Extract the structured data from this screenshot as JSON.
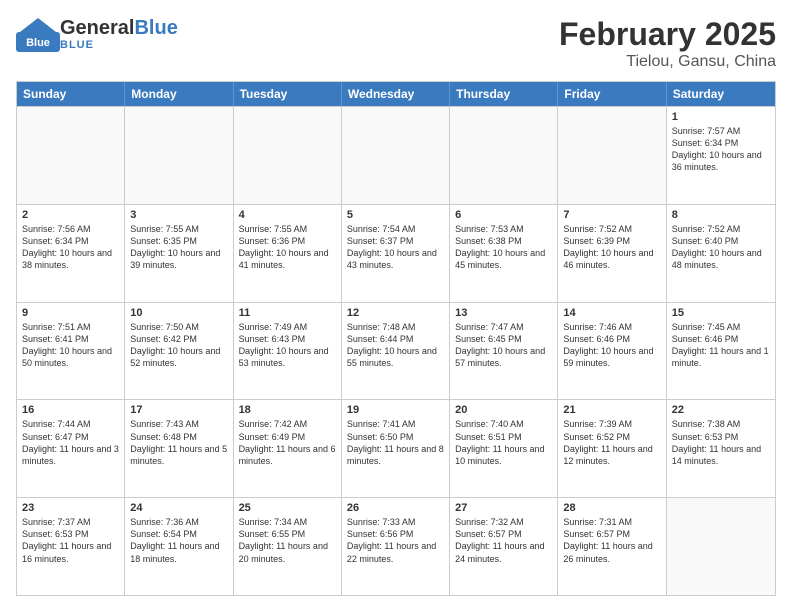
{
  "header": {
    "logo_general": "General",
    "logo_blue": "Blue",
    "title": "February 2025",
    "subtitle": "Tielou, Gansu, China"
  },
  "days_of_week": [
    "Sunday",
    "Monday",
    "Tuesday",
    "Wednesday",
    "Thursday",
    "Friday",
    "Saturday"
  ],
  "weeks": [
    [
      {
        "day": "",
        "text": ""
      },
      {
        "day": "",
        "text": ""
      },
      {
        "day": "",
        "text": ""
      },
      {
        "day": "",
        "text": ""
      },
      {
        "day": "",
        "text": ""
      },
      {
        "day": "",
        "text": ""
      },
      {
        "day": "1",
        "text": "Sunrise: 7:57 AM\nSunset: 6:34 PM\nDaylight: 10 hours and 36 minutes."
      }
    ],
    [
      {
        "day": "2",
        "text": "Sunrise: 7:56 AM\nSunset: 6:34 PM\nDaylight: 10 hours and 38 minutes."
      },
      {
        "day": "3",
        "text": "Sunrise: 7:55 AM\nSunset: 6:35 PM\nDaylight: 10 hours and 39 minutes."
      },
      {
        "day": "4",
        "text": "Sunrise: 7:55 AM\nSunset: 6:36 PM\nDaylight: 10 hours and 41 minutes."
      },
      {
        "day": "5",
        "text": "Sunrise: 7:54 AM\nSunset: 6:37 PM\nDaylight: 10 hours and 43 minutes."
      },
      {
        "day": "6",
        "text": "Sunrise: 7:53 AM\nSunset: 6:38 PM\nDaylight: 10 hours and 45 minutes."
      },
      {
        "day": "7",
        "text": "Sunrise: 7:52 AM\nSunset: 6:39 PM\nDaylight: 10 hours and 46 minutes."
      },
      {
        "day": "8",
        "text": "Sunrise: 7:52 AM\nSunset: 6:40 PM\nDaylight: 10 hours and 48 minutes."
      }
    ],
    [
      {
        "day": "9",
        "text": "Sunrise: 7:51 AM\nSunset: 6:41 PM\nDaylight: 10 hours and 50 minutes."
      },
      {
        "day": "10",
        "text": "Sunrise: 7:50 AM\nSunset: 6:42 PM\nDaylight: 10 hours and 52 minutes."
      },
      {
        "day": "11",
        "text": "Sunrise: 7:49 AM\nSunset: 6:43 PM\nDaylight: 10 hours and 53 minutes."
      },
      {
        "day": "12",
        "text": "Sunrise: 7:48 AM\nSunset: 6:44 PM\nDaylight: 10 hours and 55 minutes."
      },
      {
        "day": "13",
        "text": "Sunrise: 7:47 AM\nSunset: 6:45 PM\nDaylight: 10 hours and 57 minutes."
      },
      {
        "day": "14",
        "text": "Sunrise: 7:46 AM\nSunset: 6:46 PM\nDaylight: 10 hours and 59 minutes."
      },
      {
        "day": "15",
        "text": "Sunrise: 7:45 AM\nSunset: 6:46 PM\nDaylight: 11 hours and 1 minute."
      }
    ],
    [
      {
        "day": "16",
        "text": "Sunrise: 7:44 AM\nSunset: 6:47 PM\nDaylight: 11 hours and 3 minutes."
      },
      {
        "day": "17",
        "text": "Sunrise: 7:43 AM\nSunset: 6:48 PM\nDaylight: 11 hours and 5 minutes."
      },
      {
        "day": "18",
        "text": "Sunrise: 7:42 AM\nSunset: 6:49 PM\nDaylight: 11 hours and 6 minutes."
      },
      {
        "day": "19",
        "text": "Sunrise: 7:41 AM\nSunset: 6:50 PM\nDaylight: 11 hours and 8 minutes."
      },
      {
        "day": "20",
        "text": "Sunrise: 7:40 AM\nSunset: 6:51 PM\nDaylight: 11 hours and 10 minutes."
      },
      {
        "day": "21",
        "text": "Sunrise: 7:39 AM\nSunset: 6:52 PM\nDaylight: 11 hours and 12 minutes."
      },
      {
        "day": "22",
        "text": "Sunrise: 7:38 AM\nSunset: 6:53 PM\nDaylight: 11 hours and 14 minutes."
      }
    ],
    [
      {
        "day": "23",
        "text": "Sunrise: 7:37 AM\nSunset: 6:53 PM\nDaylight: 11 hours and 16 minutes."
      },
      {
        "day": "24",
        "text": "Sunrise: 7:36 AM\nSunset: 6:54 PM\nDaylight: 11 hours and 18 minutes."
      },
      {
        "day": "25",
        "text": "Sunrise: 7:34 AM\nSunset: 6:55 PM\nDaylight: 11 hours and 20 minutes."
      },
      {
        "day": "26",
        "text": "Sunrise: 7:33 AM\nSunset: 6:56 PM\nDaylight: 11 hours and 22 minutes."
      },
      {
        "day": "27",
        "text": "Sunrise: 7:32 AM\nSunset: 6:57 PM\nDaylight: 11 hours and 24 minutes."
      },
      {
        "day": "28",
        "text": "Sunrise: 7:31 AM\nSunset: 6:57 PM\nDaylight: 11 hours and 26 minutes."
      },
      {
        "day": "",
        "text": ""
      }
    ]
  ]
}
